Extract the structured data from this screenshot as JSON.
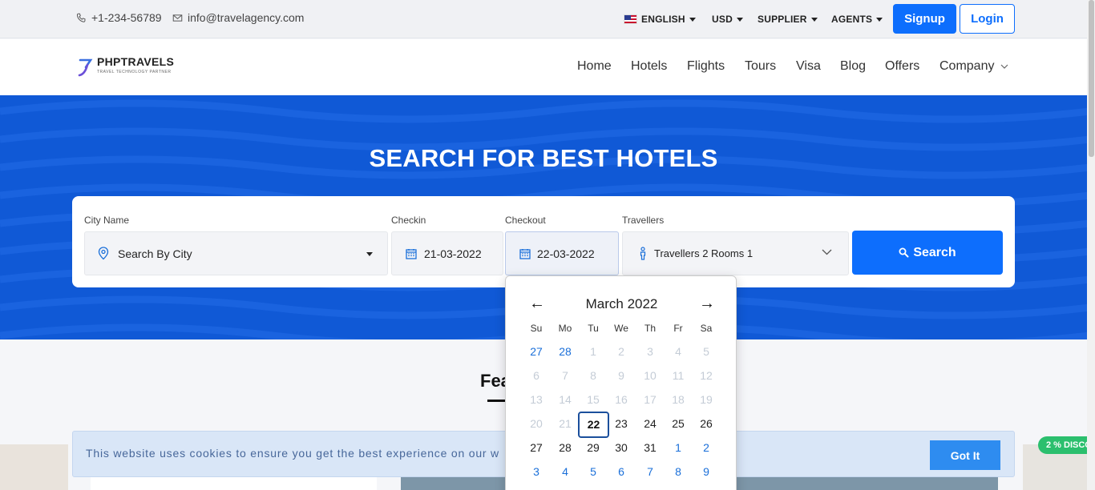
{
  "topbar": {
    "phone": "+1-234-56789",
    "email": "info@travelagency.com",
    "language": "ENGLISH",
    "currency": "USD",
    "supplier": "SUPPLIER",
    "agents": "AGENTS",
    "signup": "Signup",
    "login": "Login"
  },
  "nav": {
    "logo_name": "PHPTRAVELS",
    "logo_tagline": "TRAVEL TECHNOLOGY PARTNER",
    "links": [
      "Home",
      "Hotels",
      "Flights",
      "Tours",
      "Visa",
      "Blog",
      "Offers",
      "Company"
    ]
  },
  "hero": {
    "title": "SEARCH FOR BEST HOTELS"
  },
  "search": {
    "city_label": "City Name",
    "city_value": "Search By City",
    "checkin_label": "Checkin",
    "checkin_value": "21-03-2022",
    "checkout_label": "Checkout",
    "checkout_value": "22-03-2022",
    "travellers_label": "Travellers",
    "travellers_value": "Travellers 2 Rooms 1",
    "search_button": "Search"
  },
  "datepicker": {
    "month": "March 2022",
    "weekdays": [
      "Su",
      "Mo",
      "Tu",
      "We",
      "Th",
      "Fr",
      "Sa"
    ],
    "weeks": [
      [
        "27",
        "28",
        "1",
        "2",
        "3",
        "4",
        "5"
      ],
      [
        "6",
        "7",
        "8",
        "9",
        "10",
        "11",
        "12"
      ],
      [
        "13",
        "14",
        "15",
        "16",
        "17",
        "18",
        "19"
      ],
      [
        "20",
        "21",
        "22",
        "23",
        "24",
        "25",
        "26"
      ],
      [
        "27",
        "28",
        "29",
        "30",
        "31",
        "1",
        "2"
      ],
      [
        "3",
        "4",
        "5",
        "6",
        "7",
        "8",
        "9"
      ]
    ],
    "selected": "22"
  },
  "featured": {
    "heading": "Fea"
  },
  "badge": {
    "discount": "2 % DISCO"
  },
  "cookie": {
    "text": "This website uses cookies to ensure you get the best experience on our w",
    "button": "Got It"
  },
  "colors": {
    "primary": "#0d6efd",
    "hero_bg": "#1059d6",
    "discount": "#2bbf6e",
    "cookie_bg": "#d9e6f7"
  }
}
